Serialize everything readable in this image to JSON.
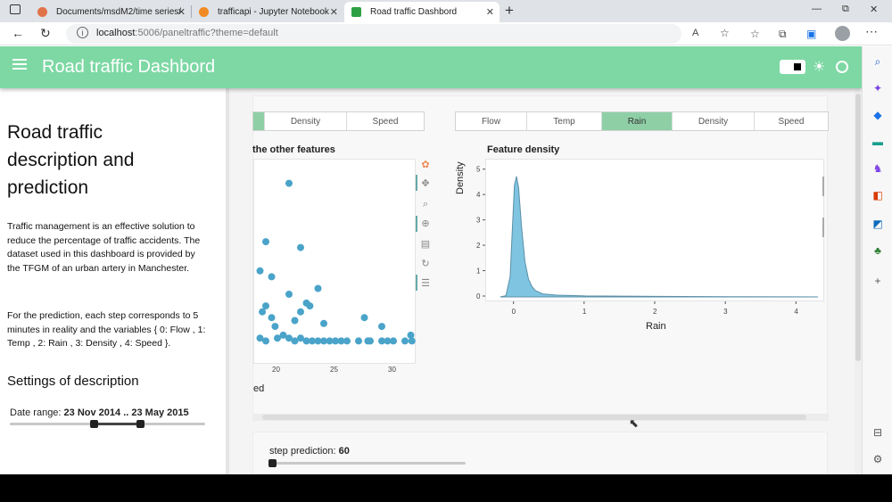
{
  "browser": {
    "tabs": [
      {
        "label": "Documents/msdM2/time series/",
        "icon_color": "#e0734a"
      },
      {
        "label": "trafficapi - Jupyter Notebook",
        "icon_color": "#f08a24"
      },
      {
        "label": "Road traffic Dashbord",
        "icon_color": "#2ea043",
        "active": true
      }
    ],
    "new_tab": "+",
    "url_host": "localhost",
    "url_rest": ":5006/paneltraffic?theme=default",
    "window_controls": {
      "minimize": "—",
      "restore": "⧉",
      "close": "✕"
    }
  },
  "header": {
    "title": "Road traffic Dashbord",
    "menu_icon": "hamburger-icon",
    "theme_icon": "sun-icon"
  },
  "sidebar": {
    "title": "Road traffic description and prediction",
    "paragraph1": "Traffic management is an effective solution to reduce the percentage of traffic accidents. The dataset used in this dashboard is provided by the TFGM of an urban artery in Manchester.",
    "paragraph2": "For the prediction, each step corresponds to 5 minutes in reality and the variables { 0: Flow , 1: Temp , 2: Rain , 3: Density , 4: Speed }.",
    "settings_heading": "Settings of description",
    "date_range": {
      "label": "Date range:",
      "value": "23 Nov 2014 .. 23 May 2015"
    }
  },
  "left_panel": {
    "tabs": [
      "Density",
      "Speed"
    ],
    "title": "the other features",
    "xlabel_partial": "ed"
  },
  "right_panel": {
    "tabs": [
      "Flow",
      "Temp",
      "Rain",
      "Density",
      "Speed"
    ],
    "active_tab": "Rain",
    "title": "Feature density"
  },
  "chart_data": [
    {
      "type": "scatter",
      "title": "the other features",
      "xlabel": "ed",
      "ylabel": "",
      "xlim": [
        18,
        32
      ],
      "x_ticks": [
        20,
        25,
        30
      ],
      "color": "#4aa3c9",
      "points": [
        [
          21,
          4.8
        ],
        [
          19,
          3.8
        ],
        [
          22,
          3.7
        ],
        [
          18.5,
          3.3
        ],
        [
          19.5,
          3.2
        ],
        [
          23.5,
          3.0
        ],
        [
          21,
          2.9
        ],
        [
          22.5,
          2.75
        ],
        [
          19,
          2.7
        ],
        [
          22.8,
          2.7
        ],
        [
          18.7,
          2.6
        ],
        [
          22,
          2.6
        ],
        [
          19.5,
          2.5
        ],
        [
          21.5,
          2.45
        ],
        [
          24,
          2.4
        ],
        [
          27.5,
          2.5
        ],
        [
          29,
          2.35
        ],
        [
          19.8,
          2.35
        ],
        [
          31.5,
          2.2
        ],
        [
          18.5,
          2.15
        ],
        [
          20,
          2.15
        ],
        [
          20.5,
          2.2
        ],
        [
          21,
          2.15
        ],
        [
          21.5,
          2.1
        ],
        [
          22,
          2.15
        ],
        [
          22.5,
          2.1
        ],
        [
          23,
          2.1
        ],
        [
          23.5,
          2.1
        ],
        [
          24,
          2.1
        ],
        [
          24.5,
          2.1
        ],
        [
          25,
          2.1
        ],
        [
          25.5,
          2.1
        ],
        [
          26,
          2.1
        ],
        [
          27,
          2.1
        ],
        [
          28,
          2.1
        ],
        [
          29,
          2.1
        ],
        [
          29.5,
          2.1
        ],
        [
          30,
          2.1
        ],
        [
          31,
          2.1
        ],
        [
          31.6,
          2.1
        ],
        [
          19,
          2.1
        ],
        [
          27.8,
          2.1
        ]
      ]
    },
    {
      "type": "area",
      "title": "Feature density",
      "xlabel": "Rain",
      "ylabel": "Density",
      "xlim": [
        -0.4,
        4.4
      ],
      "ylim": [
        0,
        5.2
      ],
      "x_ticks": [
        0,
        1,
        2,
        3,
        4
      ],
      "y_ticks": [
        0,
        1,
        2,
        3,
        4,
        5
      ],
      "color": "#7fc4e0",
      "x": [
        -0.2,
        -0.12,
        -0.06,
        0,
        0.03,
        0.06,
        0.1,
        0.15,
        0.2,
        0.25,
        0.3,
        0.4,
        0.6,
        1.0,
        1.5,
        2.0,
        3.0,
        4.3
      ],
      "y": [
        0,
        0.05,
        0.8,
        4.4,
        4.75,
        4.3,
        2.8,
        1.4,
        0.7,
        0.4,
        0.25,
        0.12,
        0.07,
        0.04,
        0.03,
        0.02,
        0.01,
        0
      ]
    }
  ],
  "step_prediction": {
    "label": "step prediction:",
    "value": "60"
  },
  "edge_icons": [
    "search-icon",
    "sparkle-icon",
    "bag-icon",
    "briefcase-icon",
    "game-icon",
    "office-icon",
    "outlook-icon",
    "tree-icon",
    "plus-icon",
    "panel-icon",
    "settings-icon"
  ]
}
